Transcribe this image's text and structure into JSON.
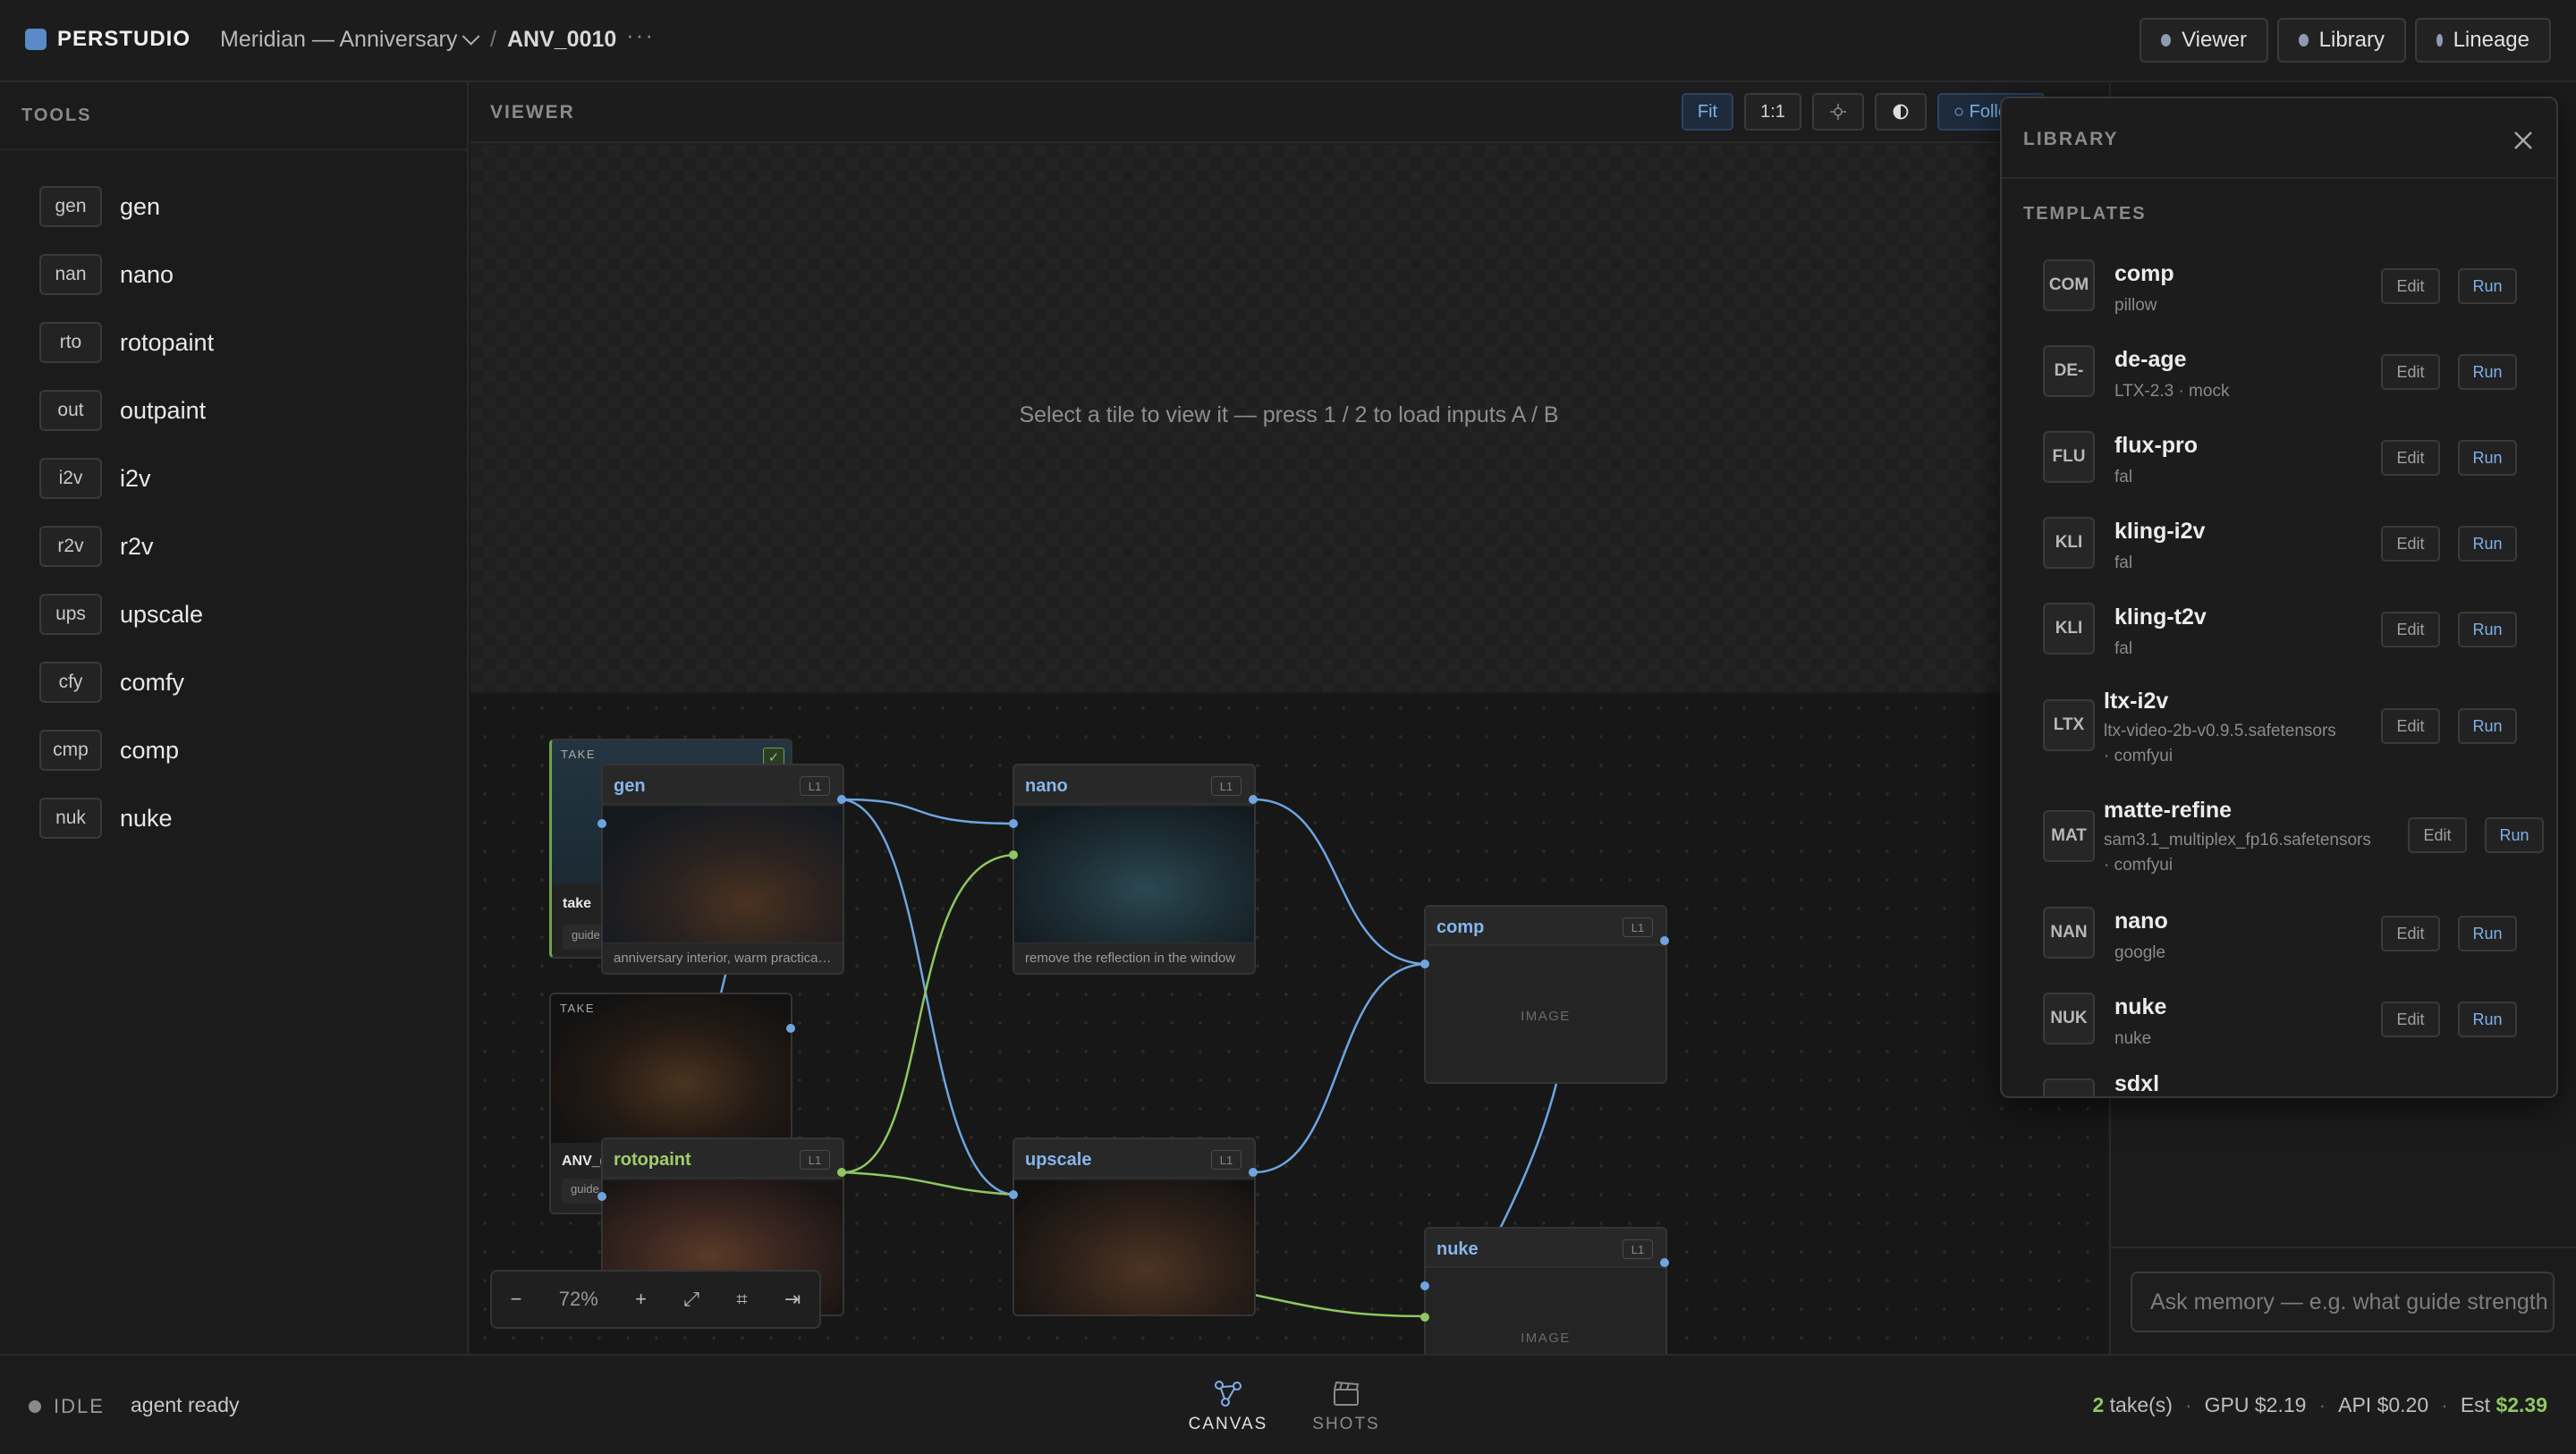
{
  "app": {
    "brand": "PERSTUDIO",
    "project": "Meridian — Anniversary",
    "crumb_sep": "/",
    "shot": "ANV_0010",
    "more": "···"
  },
  "top_buttons": {
    "viewer": "Viewer",
    "library": "Library",
    "lineage": "Lineage"
  },
  "tools": {
    "title": "TOOLS",
    "items": [
      {
        "badge": "gen",
        "label": "gen"
      },
      {
        "badge": "nan",
        "label": "nano"
      },
      {
        "badge": "rto",
        "label": "rotopaint"
      },
      {
        "badge": "out",
        "label": "outpaint"
      },
      {
        "badge": "i2v",
        "label": "i2v"
      },
      {
        "badge": "r2v",
        "label": "r2v"
      },
      {
        "badge": "ups",
        "label": "upscale"
      },
      {
        "badge": "cfy",
        "label": "comfy"
      },
      {
        "badge": "cmp",
        "label": "comp"
      },
      {
        "badge": "nuk",
        "label": "nuke"
      }
    ]
  },
  "viewer": {
    "title": "VIEWER",
    "fit": "Fit",
    "one_to_one": "1:1",
    "follow": "○ Follo",
    "message": "Select a tile to view it — press 1 / 2 to load inputs A / B"
  },
  "canvas": {
    "take1": {
      "label": "TAKE",
      "name": "take",
      "chip": "guide"
    },
    "take2": {
      "label": "TAKE",
      "name": "ANV_(",
      "chip": "guide"
    },
    "nodes": {
      "gen": {
        "title": "gen",
        "tag": "L1",
        "caption": "anniversary interior, warm practical..."
      },
      "nano": {
        "title": "nano",
        "tag": "L1",
        "caption": "remove the reflection in the window"
      },
      "comp": {
        "title": "comp",
        "tag": "L1",
        "placeholder": "IMAGE"
      },
      "rotopaint": {
        "title": "rotopaint",
        "tag": "L1"
      },
      "upscale": {
        "title": "upscale",
        "tag": "L1"
      },
      "nuke": {
        "title": "nuke",
        "tag": "L1",
        "placeholder": "IMAGE"
      }
    },
    "zoom": {
      "minus": "−",
      "level": "72%",
      "plus": "+",
      "fit": "⤢",
      "grid": "⌗",
      "end": "⇥"
    }
  },
  "library": {
    "title": "LIBRARY",
    "section": "TEMPLATES",
    "edit_label": "Edit",
    "run_label": "Run",
    "templates": [
      {
        "icon": "COM",
        "name": "comp",
        "sub": "pillow"
      },
      {
        "icon": "DE-",
        "name": "de-age",
        "sub": "LTX-2.3 · mock"
      },
      {
        "icon": "FLU",
        "name": "flux-pro",
        "sub": "fal"
      },
      {
        "icon": "KLI",
        "name": "kling-i2v",
        "sub": "fal"
      },
      {
        "icon": "KLI",
        "name": "kling-t2v",
        "sub": "fal"
      },
      {
        "icon": "LTX",
        "name": "ltx-i2v",
        "sub": "ltx-video-2b-v0.9.5.safetensors",
        "sub2": "· comfyui"
      },
      {
        "icon": "MAT",
        "name": "matte-refine",
        "sub": "sam3.1_multiplex_fp16.safetensors",
        "sub2": "· comfyui"
      },
      {
        "icon": "NAN",
        "name": "nano",
        "sub": "google"
      },
      {
        "icon": "NUK",
        "name": "nuke",
        "sub": "nuke"
      },
      {
        "icon": "SDX",
        "name": "sdxl",
        "sub": ""
      }
    ]
  },
  "memory": {
    "placeholder": "Ask memory — e.g. what guide strength"
  },
  "status": {
    "state": "IDLE",
    "agent": "agent ready",
    "tabs": {
      "canvas": "CANVAS",
      "shots": "SHOTS"
    },
    "takes_count": "2",
    "takes_label": "take(s)",
    "gpu": "GPU $2.19",
    "api": "API $0.20",
    "est_label": "Est",
    "est_value": "$2.39",
    "sep": "·"
  },
  "colors": {
    "accent_blue": "#6ea5e0",
    "accent_green": "#8fc662",
    "background": "#1a1a1a"
  }
}
